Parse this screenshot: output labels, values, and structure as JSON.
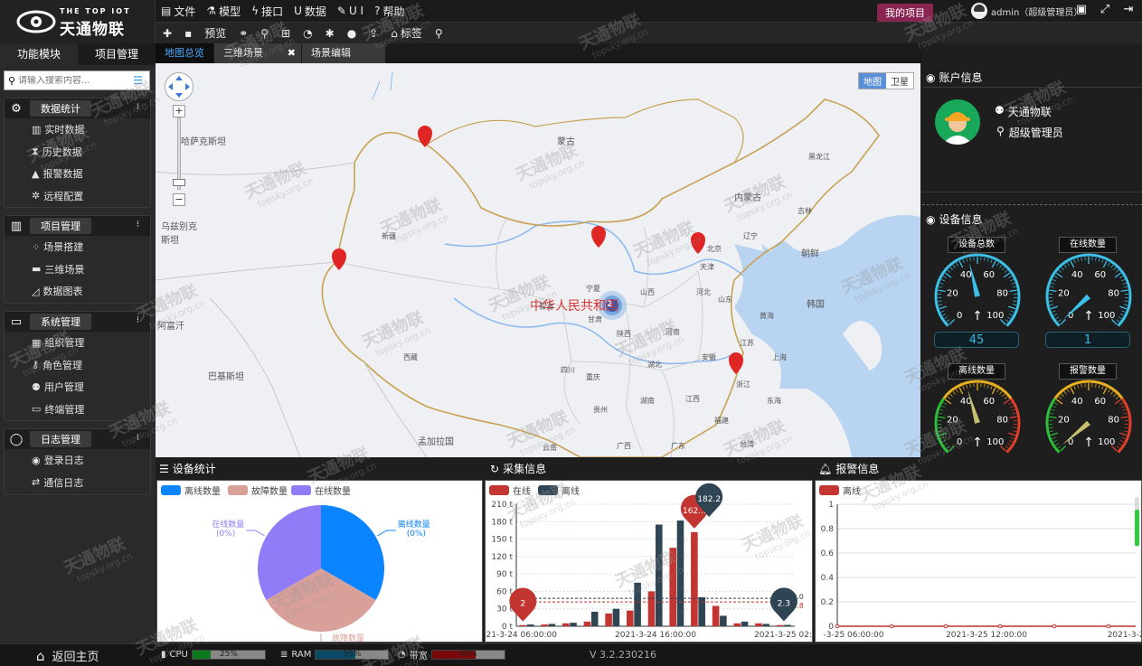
{
  "header": {
    "brand_en": "THE TOP IOT",
    "brand_cn": "天通物联",
    "menu": [
      {
        "icon": "file-icon",
        "label": "文件"
      },
      {
        "icon": "model-icon",
        "label": "模型"
      },
      {
        "icon": "interface-icon",
        "label": "接口"
      },
      {
        "icon": "data-icon",
        "label": "数据"
      },
      {
        "icon": "ui-icon",
        "label": "U I"
      },
      {
        "icon": "help-icon",
        "label": "帮助"
      }
    ],
    "toolbar": {
      "preview": "预览",
      "tag": "标签"
    },
    "my_project": "我的项目",
    "user": "admin（超级管理员）"
  },
  "sidebar": {
    "tabs": [
      "功能模块",
      "项目管理"
    ],
    "search_placeholder": "请输入搜索内容...",
    "groups": [
      {
        "title": "数据统计",
        "icon": "gear-icon",
        "items": [
          "实时数据",
          "历史数据",
          "报警数据",
          "远程配置"
        ]
      },
      {
        "title": "项目管理",
        "icon": "book-icon",
        "items": [
          "场景搭建",
          "三维场景",
          "数据图表"
        ]
      },
      {
        "title": "系统管理",
        "icon": "monitor-icon",
        "items": [
          "组织管理",
          "角色管理",
          "用户管理",
          "终端管理"
        ]
      },
      {
        "title": "日志管理",
        "icon": "chat-icon",
        "items": [
          "登录日志",
          "通信日志"
        ]
      }
    ]
  },
  "tabs": [
    "地图总览",
    "三维场景",
    "场景编辑"
  ],
  "map": {
    "type_map": "地图",
    "type_sat": "卫星",
    "labels": [
      "哈萨克斯坦",
      "蒙古",
      "乌兹别克斯坦",
      "新疆",
      "中华人民共和国",
      "阿富汗",
      "巴基斯坦",
      "西藏",
      "孟加拉国",
      "朝鲜",
      "韩国",
      "内蒙古",
      "黑龙江",
      "吉林",
      "辽宁",
      "北京",
      "天津",
      "河北",
      "山西",
      "陕西",
      "宁夏",
      "甘肃",
      "青海",
      "四川",
      "重庆",
      "湖北",
      "河南",
      "山东",
      "江苏",
      "安徽",
      "浙江",
      "上海",
      "东海",
      "黄海",
      "江西",
      "湖南",
      "贵州",
      "云南",
      "广西",
      "广东",
      "福建",
      "台湾"
    ],
    "cluster_count": "2"
  },
  "account": {
    "title": "账户信息",
    "name": "天通物联",
    "role": "超级管理员"
  },
  "device": {
    "title": "设备信息",
    "gauges": [
      {
        "label": "设备总数",
        "value": "45",
        "ratio": 0.45
      },
      {
        "label": "在线数量",
        "value": "1",
        "ratio": 0.01
      },
      {
        "label": "离线数量",
        "value": "",
        "ratio": 0.44
      },
      {
        "label": "报警数量",
        "value": "",
        "ratio": 0.02
      }
    ],
    "ticks": [
      "0",
      "20",
      "40",
      "60",
      "80",
      "100"
    ]
  },
  "stats": {
    "title": "设备统计",
    "legend": [
      "离线数量",
      "故障数量",
      "在线数量"
    ],
    "labels": [
      {
        "name": "离线数量",
        "pct": "(0%)"
      },
      {
        "name": "故障数量",
        "pct": "(0%)"
      },
      {
        "name": "在线数量",
        "pct": "(0%)"
      }
    ]
  },
  "collect": {
    "title": "采集信息",
    "legend": [
      "在线",
      "离线"
    ]
  },
  "alarm": {
    "title": "报警信息",
    "legend": [
      "离线"
    ]
  },
  "footer": {
    "home": "返回主页",
    "cpu": "CPU",
    "cpu_pct": "25%",
    "ram": "RAM",
    "ram_pct": "55%",
    "bw": "带宽",
    "bw_pct": "60%",
    "version": "V 3.2.230216"
  },
  "watermark": {
    "cn": "天通物联",
    "url": "topsky.org.cn"
  },
  "chart_data": [
    {
      "type": "pie",
      "title": "设备统计",
      "series": [
        {
          "name": "离线数量",
          "value": 1
        },
        {
          "name": "故障数量",
          "value": 1
        },
        {
          "name": "在线数量",
          "value": 1
        }
      ]
    },
    {
      "type": "bar",
      "title": "采集信息",
      "x": [
        "2021-3-24 06:00:00",
        "",
        "",
        "",
        "",
        "",
        "2021-3-24 16:00:00",
        "",
        "",
        "",
        "",
        "",
        "2021-3-25 02:00:00"
      ],
      "xticks": [
        "2021-3-24 06:00:00",
        "2021-3-24 16:00:00",
        "2021-3-25 02:00:00"
      ],
      "yticks": [
        "0 t",
        "30 t",
        "60 t",
        "90 t",
        "120 t",
        "150 t",
        "180 t",
        "210 t"
      ],
      "ylim": [
        0,
        210
      ],
      "series": [
        {
          "name": "在线",
          "values": [
            2,
            3,
            5,
            8,
            22,
            27,
            60,
            135,
            162,
            35,
            5,
            5,
            2
          ]
        },
        {
          "name": "离线",
          "values": [
            3,
            4,
            6,
            25,
            30,
            75,
            175,
            182,
            50,
            18,
            8,
            4,
            2.3
          ]
        }
      ],
      "max_labels": [
        {
          "series": "在线",
          "value": "162..."
        },
        {
          "series": "离线",
          "value": "182.2"
        }
      ],
      "min_labels": [
        {
          "series": "在线",
          "value": "2"
        },
        {
          "series": "离线",
          "value": "2.3"
        }
      ],
      "marklines": [
        "48.0",
        "41.8"
      ]
    },
    {
      "type": "line",
      "title": "报警信息",
      "xticks": [
        "-3-25 06:00:00",
        "2021-3-25 12:00:00",
        "2021-3-25"
      ],
      "yticks": [
        "0",
        "0.2",
        "0.4",
        "0.6",
        "0.8",
        "1"
      ],
      "ylim": [
        0,
        1
      ],
      "series": [
        {
          "name": "离线",
          "values": [
            0,
            0,
            0,
            0,
            0,
            0,
            0,
            0,
            0,
            0,
            0,
            0
          ]
        }
      ]
    }
  ]
}
